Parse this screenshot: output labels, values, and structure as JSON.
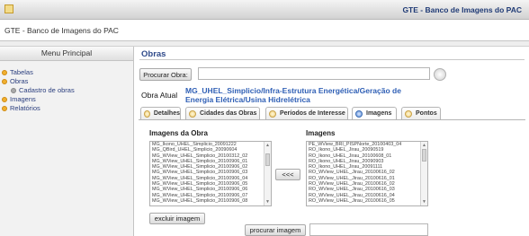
{
  "banner": {
    "title": "GTE - Banco de Imagens do PAC"
  },
  "app": {
    "title": "GTE - Banco de Imagens do PAC"
  },
  "sidebar": {
    "header": "Menu Principal",
    "items": [
      {
        "label": "Tabelas"
      },
      {
        "label": "Obras"
      },
      {
        "label": "Cadastro de obras"
      },
      {
        "label": "Imagens"
      },
      {
        "label": "Relatórios"
      }
    ]
  },
  "main": {
    "title": "Obras",
    "search": {
      "button_label": "Procurar Obra:",
      "value": ""
    },
    "obra_atual": {
      "label": "Obra Atual",
      "value": "MG_UHEL_Simplicio/Infra-Estrutura Energética/Geração de Energia Elétrica/Usina Hidrelétrica"
    },
    "tabs": [
      {
        "label": "Detalhes",
        "active": false
      },
      {
        "label": "Cidades das Obras",
        "active": false
      },
      {
        "label": "Períodos de Interesse",
        "active": false
      },
      {
        "label": "Imagens",
        "active": true
      },
      {
        "label": "Pontos",
        "active": false
      }
    ],
    "images_of_obra": {
      "title": "Imagens da Obra",
      "items": [
        "MG_Ikono_UHEL_Simplicio_20091222",
        "MG_QBird_UHEL_Simplicio_20090604",
        "MG_WView_UHEL_Simplicio_20100312_02",
        "MG_WView_UHEL_Simplicio_20100906_01",
        "MG_WView_UHEL_Simplicio_20100906_02",
        "MG_WView_UHEL_Simplicio_20100906_03",
        "MG_WView_UHEL_Simplicio_20100906_04",
        "MG_WView_UHEL_Simplicio_20100906_05",
        "MG_WView_UHEL_Simplicio_20100906_06",
        "MG_WView_UHEL_Simplicio_20100906_07",
        "MG_WView_UHEL_Simplicio_20100906_08"
      ]
    },
    "move_button": "<<<",
    "images": {
      "title": "Imagens",
      "items": [
        "PE_WView_BRI_PISPNorte_20100403_04",
        "RO_Ikono_UHEL_Jirau_20090519",
        "RO_Ikono_UHEL_Jirau_20100608_01",
        "RO_Ikono_UHEL_Jirau_20090903",
        "RO_Ikono_UHEL_Jirau_20091111",
        "RO_WView_UHEL_Jirau_20100616_02",
        "RO_WView_UHEL_Jirau_20100616_01",
        "RO_WView_UHEL_Jirau_20100616_02",
        "RO_WView_UHEL_Jirau_20100616_03",
        "RO_WView_UHEL_Jirau_20100616_04",
        "RO_WView_UHEL_Jirau_20100616_05"
      ]
    },
    "delete_button": "excluir imagem",
    "search_image_button": "procurar imagem",
    "search_image_value": ""
  }
}
